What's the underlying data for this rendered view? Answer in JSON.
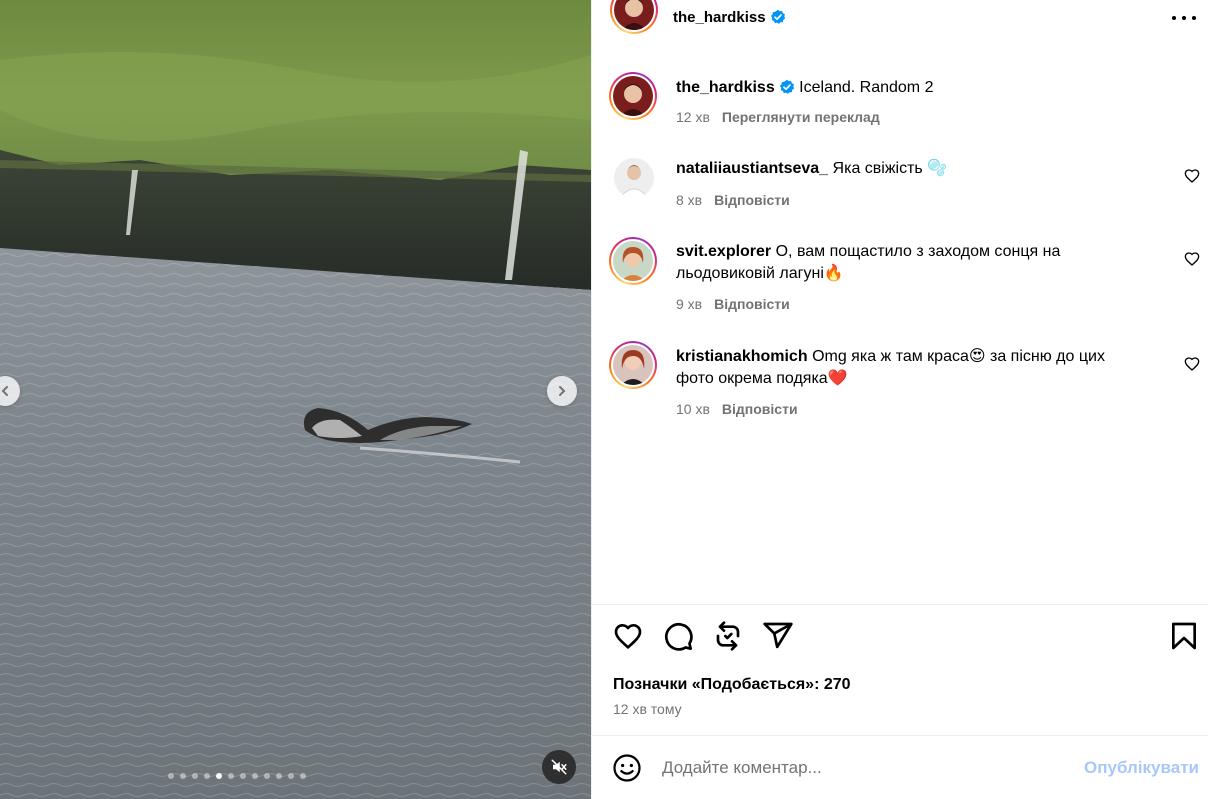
{
  "media": {
    "slide_count": 12,
    "active_slide_index": 4,
    "prev_icon": "chevron-left-icon",
    "next_icon": "chevron-right-icon",
    "mute_icon": "speaker-muted-icon"
  },
  "post": {
    "author": "the_hardkiss",
    "verified": true,
    "more_icon": "more-horizontal-icon"
  },
  "caption": {
    "user": "the_hardkiss",
    "text": "Iceland. Random 2",
    "time": "12 хв",
    "translate_label": "Переглянути переклад"
  },
  "comments": [
    {
      "user": "nataliiaustiantseva_",
      "text": "Яка свіжість 🫧",
      "time": "8 хв",
      "reply_label": "Відповісти"
    },
    {
      "user": "svit.explorer",
      "text": "О, вам пощастило з заходом сонця на льодовиковій лагуні🔥",
      "time": "9 хв",
      "reply_label": "Відповісти"
    },
    {
      "user": "kristianakhomich",
      "text": "Omg яка ж там краса😍 за пісню до цих фото окрема подяка❤️",
      "time": "10 хв",
      "reply_label": "Відповісти"
    }
  ],
  "actions": {
    "like_icon": "heart-icon",
    "comment_icon": "comment-icon",
    "repost_icon": "repost-icon",
    "share_icon": "send-icon",
    "save_icon": "bookmark-icon"
  },
  "likes_text": "Позначки «Подобається»: 270",
  "posted_ago": "12 хв тому",
  "comment_box": {
    "placeholder": "Додайте коментар...",
    "value": "",
    "publish_label": "Опублікувати",
    "emoji_icon": "smiley-icon"
  },
  "colors": {
    "link_disabled": "#a8c7fa",
    "verified": "#0095f6",
    "secondary_text": "#737373"
  }
}
